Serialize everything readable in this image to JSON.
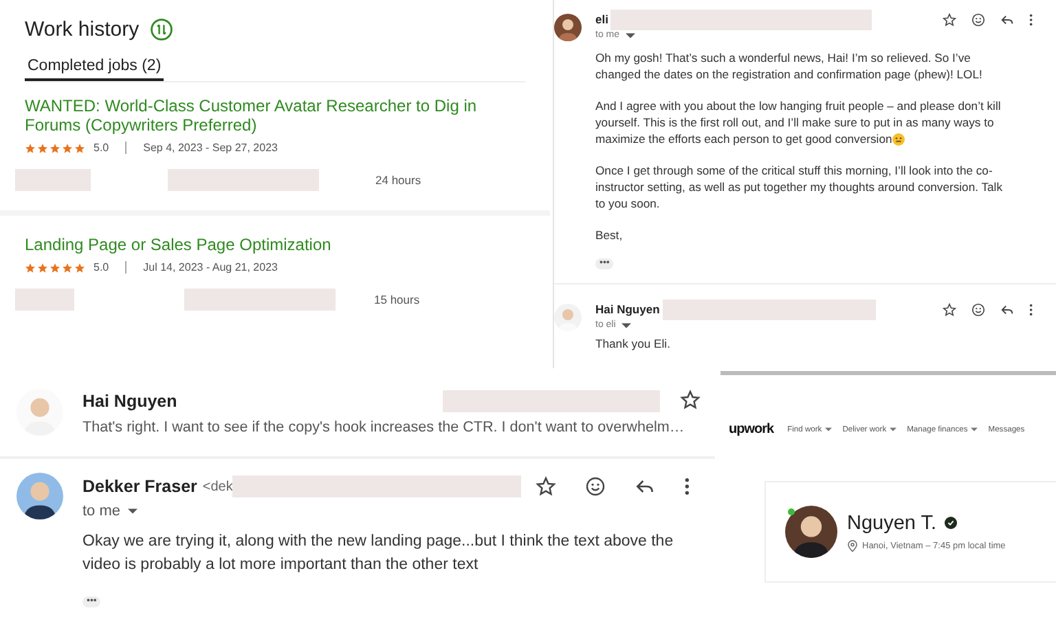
{
  "work_history": {
    "title": "Work history",
    "tabs": [
      {
        "label": "Completed jobs (2)",
        "selected": true
      }
    ],
    "jobs": [
      {
        "title": "WANTED: World-Class Customer Avatar Researcher to Dig in Forums (Copywriters Preferred)",
        "stars": 5,
        "rating": "5.0",
        "dates": "Sep 4, 2023 - Sep 27, 2023",
        "hours": "24 hours"
      },
      {
        "title": "Landing Page or Sales Page Optimization",
        "stars": 5,
        "rating": "5.0",
        "dates": "Jul 14, 2023 - Aug 21, 2023",
        "hours": "15 hours"
      }
    ]
  },
  "email_thread": {
    "messages": [
      {
        "sender": "eli",
        "recipient": "to me",
        "paragraphs": [
          {
            "text": "Oh my gosh! That’s such a wonderful news, Hai! I’m so relieved. So I’ve changed the dates on the registration and confirmation page (phew)! LOL!",
            "emoji": false
          },
          {
            "text": "And I agree with you about the low hanging fruit people – and please don’t kill yourself. This is the first roll out, and I’ll make sure to put in as many ways to maximize the efforts each person to get good conversion",
            "emoji": true
          },
          {
            "text": "Once I get through some of the critical stuff this morning, I’ll look into the co-instructor setting, as well as put together my thoughts around conversion. Talk to you soon.",
            "emoji": false
          },
          {
            "text": "Best,",
            "emoji": false
          }
        ],
        "more": "•••"
      },
      {
        "sender": "Hai Nguyen",
        "recipient": "to eli",
        "paragraphs": [
          {
            "text": "Thank you Eli.",
            "emoji": false
          }
        ]
      }
    ]
  },
  "inbox_row": {
    "sender": "Hai Nguyen",
    "snippet": "That's right. I want to see if the copy's hook increases the CTR. I don't want to overwhelm…",
    "starred": false
  },
  "open_message": {
    "sender": "Dekker Fraser",
    "address": "<dek",
    "recipient": "to me",
    "body": "Okay we are trying it, along with the new landing page...but I think the text above the video is probably a lot more important than the other text",
    "more": "•••"
  },
  "upwork": {
    "logo": "upwork",
    "nav": [
      {
        "label": "Find work",
        "dropdown": true
      },
      {
        "label": "Deliver work",
        "dropdown": true
      },
      {
        "label": "Manage finances",
        "dropdown": true
      },
      {
        "label": "Messages",
        "dropdown": false
      }
    ],
    "profile": {
      "name": "Nguyen T.",
      "verified": true,
      "online": true,
      "location": "Hanoi, Vietnam – 7:45 pm local time"
    }
  }
}
